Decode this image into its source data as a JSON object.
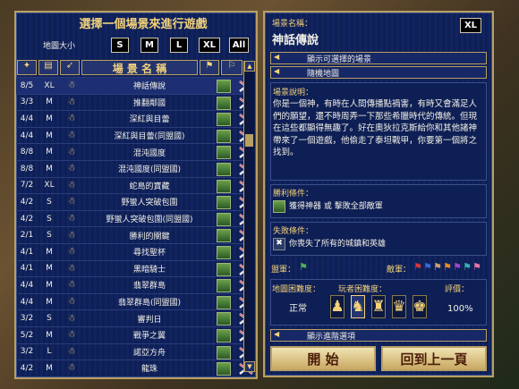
{
  "title": "選擇一個場景來進行遊戲",
  "map_size_label": "地圖大小",
  "size_buttons": [
    "S",
    "M",
    "L",
    "XL",
    "All"
  ],
  "columns": {
    "name": "場 景 名 稱"
  },
  "scenarios": [
    {
      "players": "8/5",
      "size": "XL",
      "name": "神話傳說",
      "selected": true
    },
    {
      "players": "3/3",
      "size": "M",
      "name": "推翻鄰國"
    },
    {
      "players": "4/4",
      "size": "M",
      "name": "深紅與目蕾"
    },
    {
      "players": "4/4",
      "size": "M",
      "name": "深紅與目蕾(同盟國)"
    },
    {
      "players": "8/8",
      "size": "M",
      "name": "混沌國度"
    },
    {
      "players": "8/8",
      "size": "M",
      "name": "混沌國度(同盟國)"
    },
    {
      "players": "7/2",
      "size": "XL",
      "name": "蛇島的寶藏"
    },
    {
      "players": "4/2",
      "size": "S",
      "name": "野蠻人突破包圍"
    },
    {
      "players": "4/2",
      "size": "S",
      "name": "野蠻人突破包圍(同盟國)"
    },
    {
      "players": "2/1",
      "size": "S",
      "name": "勝利的關鍵"
    },
    {
      "players": "4/1",
      "size": "M",
      "name": "尋找聖杯"
    },
    {
      "players": "4/1",
      "size": "M",
      "name": "黑暗騎士"
    },
    {
      "players": "4/4",
      "size": "M",
      "name": "翡翠群島"
    },
    {
      "players": "4/4",
      "size": "M",
      "name": "翡翠群島(同盟國)"
    },
    {
      "players": "3/2",
      "size": "S",
      "name": "審判日"
    },
    {
      "players": "5/2",
      "size": "M",
      "name": "戰爭之翼"
    },
    {
      "players": "3/2",
      "size": "L",
      "name": "諾亞方舟"
    },
    {
      "players": "4/2",
      "size": "M",
      "name": "龍珠"
    }
  ],
  "detail": {
    "name_label": "場景名稱：",
    "name": "神話傳說",
    "size_badge": "XL",
    "show_scenarios": "顯示可選擇的場景",
    "random_map": "隨機地圖",
    "desc_label": "場景說明：",
    "description": "你是一個神，有時在人間傳播點禍害，有時又會滿足人們的願望，還不時周弄一下那些希臘時代的傳統。但現在這些都顯得無趣了。好在奧狄拉克斯給你和其他諸神帶來了一個遊戲，他偷走了泰坦戰甲，你要第一個將之找到。",
    "victory_label": "勝利條件：",
    "victory": "獲得神器 或 擊敗全部敵軍",
    "loss_label": "失敗條件：",
    "loss": "你喪失了所有的城鎮和英雄",
    "allies_label": "盟軍：",
    "enemies_label": "敵軍：",
    "difficulty_label": "地圖困難度：",
    "player_difficulty_label": "玩者困難度：",
    "rating_label": "評價：",
    "difficulty": "正常",
    "rating": "100%",
    "advanced": "顯示進階選項"
  },
  "buttons": {
    "start": "開 始",
    "back": "回到上一頁"
  },
  "colors": {
    "panel": "#0c1c4e",
    "border": "#b8a063",
    "accent": "#f3d27a"
  }
}
